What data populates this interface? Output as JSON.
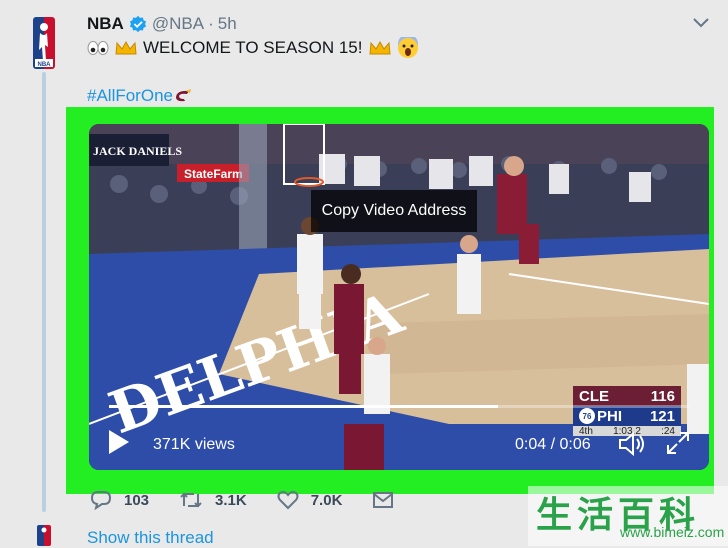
{
  "tweet": {
    "name": "NBA",
    "handle": "@NBA",
    "separator": "·",
    "time": "5h",
    "text": "WELCOME TO SEASON 15!",
    "hashtag": "#AllForOne"
  },
  "video": {
    "context_menu": "Copy Video Address",
    "views": "371K views",
    "timecode": "0:04 / 0:06",
    "progress": 0.67,
    "arena_sign": "JACK DANIELS",
    "sponsor_sign": "StateFarm",
    "court_text": "DELPHIA",
    "scoreboard": {
      "team1": "CLE",
      "score1": "116",
      "team2": "PHI",
      "score2": "121",
      "logo2": "76",
      "period": "4th",
      "clock": "1:03.2",
      "shot": ":24"
    }
  },
  "actions": {
    "replies": "103",
    "retweets": "3.1K",
    "likes": "7.0K"
  },
  "show_thread": "Show this thread",
  "watermark": {
    "chars": "生活百科",
    "url": "www.bimeiz.com"
  },
  "colors": {
    "highlight": "#22ee22",
    "link": "#1b95e0",
    "verified": "#1da1f2"
  }
}
